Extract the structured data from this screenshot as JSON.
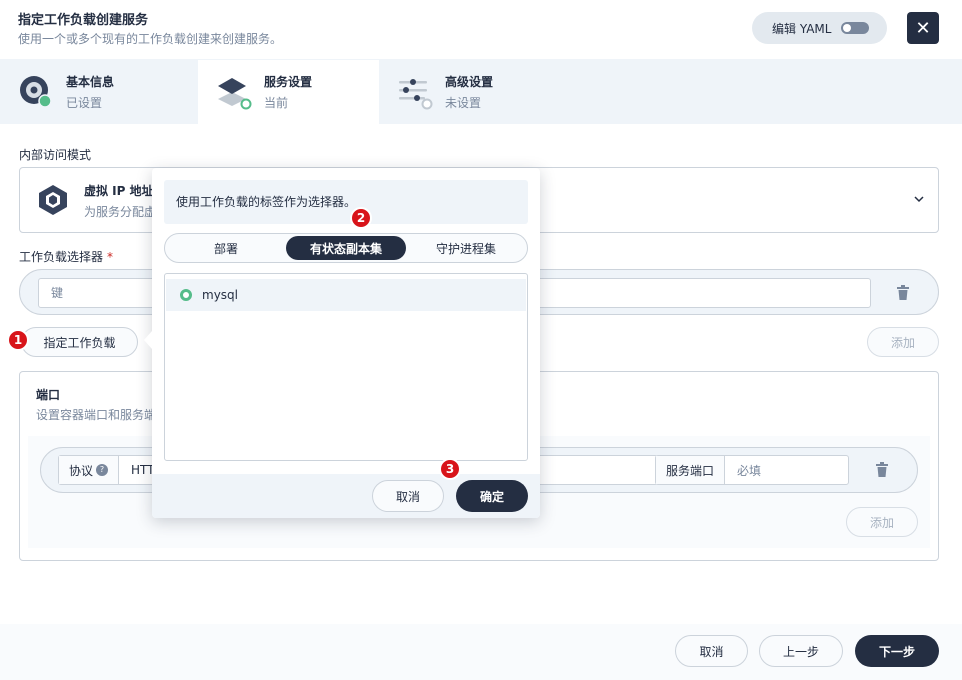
{
  "header": {
    "title": "指定工作负载创建服务",
    "subtitle": "使用一个或多个现有的工作负载创建来创建服务。",
    "yaml_label": "编辑 YAML",
    "close_symbol": "✕"
  },
  "steps": [
    {
      "name": "基本信息",
      "status": "已设置"
    },
    {
      "name": "服务设置",
      "status": "当前"
    },
    {
      "name": "高级设置",
      "status": "未设置"
    }
  ],
  "access": {
    "section_label": "内部访问模式",
    "name": "虚拟 IP 地址",
    "desc": "为服务分配虚"
  },
  "selector": {
    "section_label": "工作负载选择器",
    "required_mark": "*",
    "key_placeholder": "键",
    "specify_button": "指定工作负载",
    "add_button": "添加"
  },
  "ports": {
    "title": "端口",
    "desc": "设置容器端口和服务端",
    "protocol_label": "协议",
    "protocol_value": "HTT",
    "service_port_label": "服务端口",
    "service_port_placeholder": "必填",
    "add_button": "添加"
  },
  "popover": {
    "hint": "使用工作负载的标签作为选择器。",
    "tabs": [
      "部署",
      "有状态副本集",
      "守护进程集"
    ],
    "active_tab": "有状态副本集",
    "items": [
      "mysql"
    ],
    "cancel_button": "取消",
    "confirm_button": "确定"
  },
  "footer": {
    "cancel_button": "取消",
    "prev_button": "上一步",
    "next_button": "下一步"
  },
  "badges": [
    "1",
    "2",
    "3"
  ],
  "colors": {
    "dark": "#242e42",
    "accent_green": "#55bc8a",
    "badge_red": "#d8141a",
    "light_bg": "#eff4f9",
    "border": "#ccd3db"
  }
}
